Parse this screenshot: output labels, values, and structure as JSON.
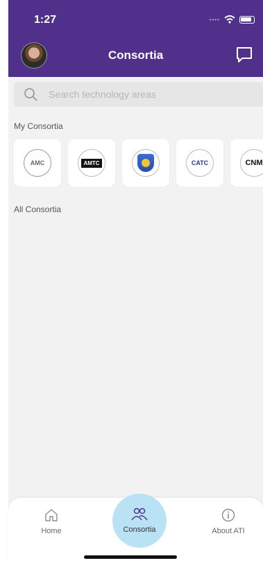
{
  "status_bar": {
    "time": "1:27"
  },
  "header": {
    "title": "Consortia"
  },
  "search": {
    "placeholder": "Search technology areas"
  },
  "sections": {
    "my_consortia": "My Consortia",
    "all_consortia": "All Consortia"
  },
  "consortia_logos": [
    {
      "name": "amc-logo",
      "text": "AMC"
    },
    {
      "name": "amtc-logo",
      "text": "AMTC"
    },
    {
      "name": "shield-logo",
      "text": ""
    },
    {
      "name": "catc-logo",
      "text": "CATC"
    },
    {
      "name": "cnm-logo",
      "text": "CNM"
    }
  ],
  "tabs": [
    {
      "label": "Home",
      "icon": "home-icon"
    },
    {
      "label": "Consortia",
      "icon": "people-icon"
    },
    {
      "label": "About ATI",
      "icon": "info-icon"
    }
  ],
  "colors": {
    "header": "#51308c",
    "active_tab": "#b9e3f5",
    "background": "#f2f2f2"
  }
}
